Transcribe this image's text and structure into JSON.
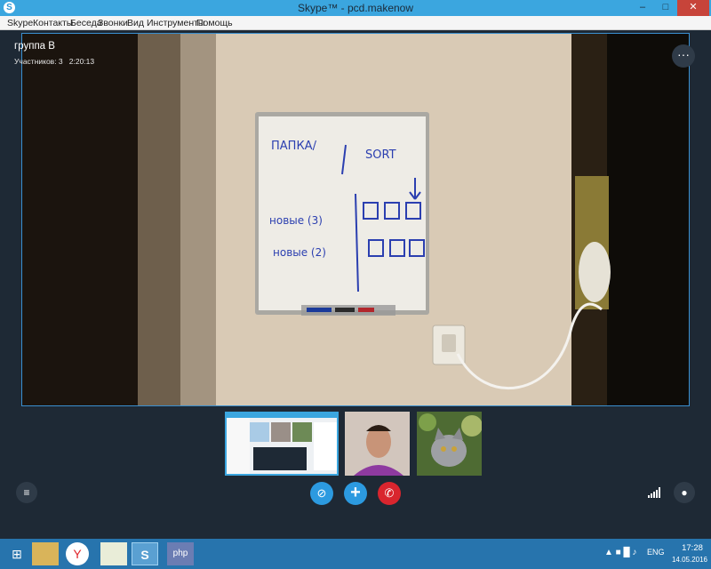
{
  "window": {
    "title": "Skype™ - pcd.makenow",
    "app_icon_letter": "S"
  },
  "menu": [
    {
      "label": "Skype",
      "name": "menu-skype"
    },
    {
      "label": "Контакты",
      "name": "menu-contacts"
    },
    {
      "label": "Беседа",
      "name": "menu-conversation"
    },
    {
      "label": "Звонки",
      "name": "menu-calls"
    },
    {
      "label": "Вид",
      "name": "menu-view"
    },
    {
      "label": "Инструменты",
      "name": "menu-tools"
    },
    {
      "label": "Помощь",
      "name": "menu-help"
    }
  ],
  "call": {
    "title": "группа В",
    "participants_label": "Участников: 3",
    "duration": "2:20:13",
    "more_glyph": "···"
  },
  "whiteboard": {
    "line1_left": "ПАПКА/",
    "line1_right": "SORT",
    "line2": "новые (3)",
    "line3": "новые (2)"
  },
  "controls": {
    "list_icon": "list-icon",
    "mute_icon": "microphone-muted-icon",
    "add_icon": "plus-icon",
    "hangup_icon": "hang-up-icon",
    "chat_icon": "chat-icon",
    "signal_icon": "signal-strength-icon"
  },
  "taskbar": {
    "apps": [
      "windows-start-icon",
      "file-explorer-icon",
      "yandex-browser-icon",
      "notepad-icon",
      "skype-icon",
      "php-icon"
    ],
    "language": "ENG",
    "time": "17:28",
    "date": "14.05.2016"
  },
  "colors": {
    "accent": "#2c9ae0",
    "hangup": "#d9252e",
    "titlebar": "#3ba6df",
    "taskbar": "#2774ad"
  }
}
